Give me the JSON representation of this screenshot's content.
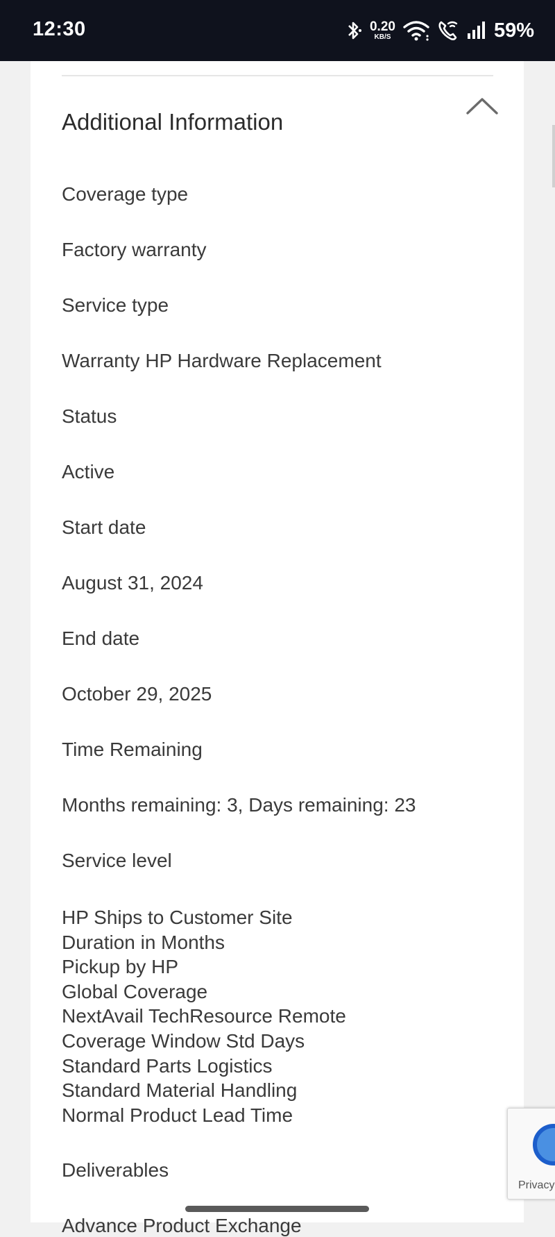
{
  "status_bar": {
    "time": "12:30",
    "net_speed_value": "0.20",
    "net_speed_unit": "KB/S",
    "battery": "59%",
    "icons": [
      "bluetooth-icon",
      "wifi-icon",
      "wifi-calling-icon",
      "signal-icon"
    ]
  },
  "section": {
    "title": "Additional Information",
    "collapse_icon": "chevron-up-icon"
  },
  "fields": [
    {
      "label": "Coverage type",
      "value": "Factory warranty"
    },
    {
      "label": "Service type",
      "value": "Warranty HP Hardware Replacement"
    },
    {
      "label": "Status",
      "value": "Active"
    },
    {
      "label": "Start date",
      "value": "August 31, 2024"
    },
    {
      "label": "End date",
      "value": "October 29, 2025"
    },
    {
      "label": "Time Remaining",
      "value": "Months remaining: 3, Days remaining: 23"
    }
  ],
  "service_level": {
    "label": "Service level",
    "items": [
      "HP Ships to Customer Site",
      "Duration in Months",
      "Pickup by HP",
      "Global Coverage",
      "NextAvail TechResource Remote",
      "Coverage Window Std Days",
      "Standard Parts Logistics",
      "Standard Material Handling",
      "Normal Product Lead Time"
    ]
  },
  "deliverables": {
    "label": "Deliverables",
    "partial_next": "Advance Product Exchange"
  },
  "recaptcha": {
    "text": "Privacy"
  }
}
